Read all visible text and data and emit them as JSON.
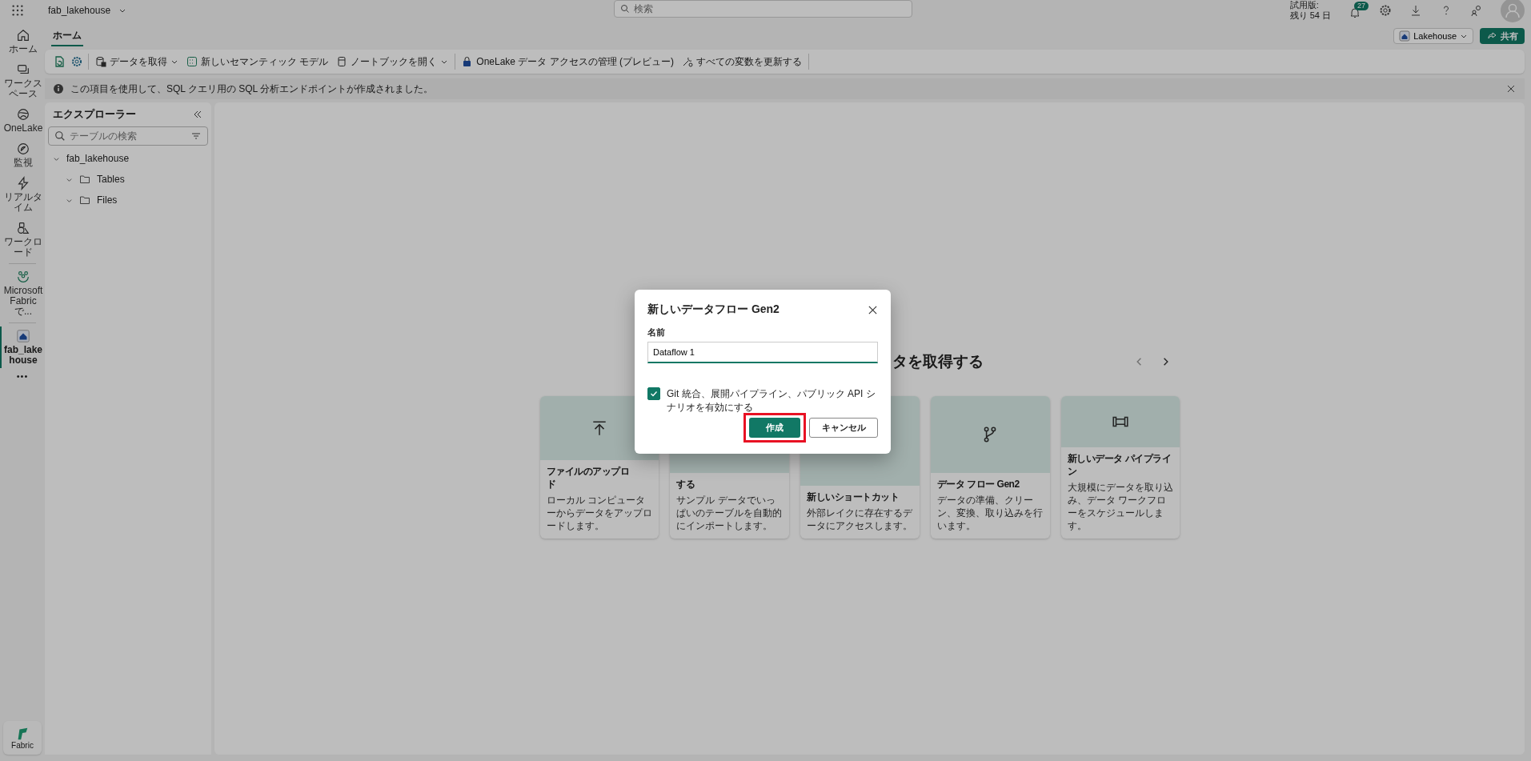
{
  "top_bar": {
    "workspace": "fab_lakehouse",
    "search": {
      "placeholder": "検索"
    },
    "trial": [
      "試用版:",
      "残り 54 日"
    ],
    "notifications": "27"
  },
  "ribbon": {
    "tabs": [
      {
        "label": "ホーム",
        "selected": true
      }
    ],
    "item_type": "Lakehouse",
    "share": "共有",
    "toolbar": [
      {
        "kind": "icon"
      },
      {
        "kind": "icon"
      },
      {
        "kind": "sep"
      },
      {
        "kind": "button",
        "label": "データを取得",
        "dropdown": true
      },
      {
        "kind": "button",
        "label": "新しいセマンティック モデル",
        "dropdown": false
      },
      {
        "kind": "button",
        "label": "ノートブックを開く",
        "dropdown": true
      },
      {
        "kind": "sep"
      },
      {
        "kind": "button",
        "label": "OneLake データ アクセスの管理 (プレビュー)",
        "dropdown": false
      },
      {
        "kind": "button",
        "label": "すべての変数を更新する",
        "dropdown": false
      },
      {
        "kind": "sep"
      }
    ]
  },
  "info_bar": "この項目を使用して、SQL クエリ用の SQL 分析エンドポイントが作成されました。",
  "rail": [
    {
      "label": "ホーム",
      "selected": false
    },
    {
      "label": "ワークスペース",
      "selected": false
    },
    {
      "label": "OneLake",
      "selected": false
    },
    {
      "label": "監視",
      "selected": false
    },
    {
      "label": "リアルタイム",
      "selected": false
    },
    {
      "label": "ワークロード",
      "selected": false
    },
    {
      "label": "Microsoft Fabric で...",
      "selected": false
    },
    {
      "label": "fab_lakehouse",
      "selected": true
    }
  ],
  "rail_more": "•••",
  "rail_bottom": "Fabric",
  "explorer": {
    "title": "エクスプローラー",
    "search": {
      "placeholder": "テーブルの検索"
    },
    "tree": [
      {
        "label": "fab_lakehouse",
        "expanded": true,
        "children": [
          {
            "label": "Tables",
            "expanded": false
          },
          {
            "label": "Files",
            "expanded": false
          }
        ]
      }
    ]
  },
  "main": {
    "heading": "タを取得する",
    "cards": [
      {
        "title": [
          "ファイルのアップロ",
          "ド"
        ],
        "description": "ローカル コンピューターからデータをアップロードします。"
      },
      {
        "title": [
          "する"
        ],
        "description": "サンプル データでいっぱいのテーブルを自動的にインポートします。"
      },
      {
        "title": [
          "新しいショートカット"
        ],
        "description": "外部レイクに存在するデータにアクセスします。"
      },
      {
        "title": [
          "データ フロー Gen2"
        ],
        "description": "データの準備、クリーン、変換、取り込みを行います。"
      },
      {
        "title": [
          "新しいデータ パイプライ",
          "ン"
        ],
        "description": "大規模にデータを取り込み、データ ワークフローをスケジュールします。"
      }
    ]
  },
  "dialog": {
    "title": "新しいデータフロー Gen2",
    "field_label": "名前",
    "field_value": "Dataflow 1",
    "option": {
      "label": "Git 統合、展開パイプライン、パブリック API シナリオを有効にする",
      "checked": true
    },
    "buttons": [
      {
        "label": "作成",
        "kind": "primary",
        "highlighted": true
      },
      {
        "label": "キャンセル",
        "kind": "secondary",
        "highlighted": false
      }
    ]
  }
}
